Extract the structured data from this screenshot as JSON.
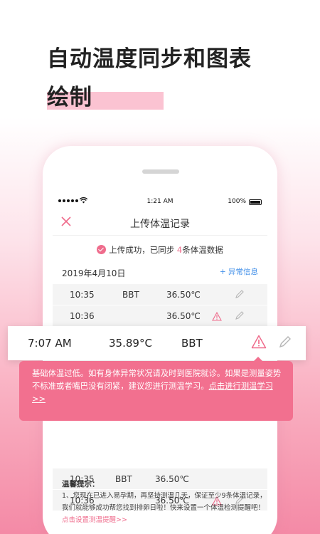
{
  "headline": {
    "line1": "自动温度同步和图表",
    "line2": "绘制"
  },
  "status_bar": {
    "time": "1:21 AM",
    "battery": "100%"
  },
  "nav": {
    "title": "上传体温记录"
  },
  "upload_message": {
    "prefix": "上传成功，已同步 ",
    "count": "4",
    "suffix": "条体温数据"
  },
  "date": "2019年4月10日",
  "anomaly_link": "+ 异常信息",
  "records_top": [
    {
      "time": "10:35",
      "type": "BBT",
      "temp": "36.50℃",
      "warning": false
    },
    {
      "time": "10:36",
      "type": "",
      "temp": "36.50℃",
      "warning": true
    }
  ],
  "highlight_record": {
    "time": "7:07 AM",
    "temp": "35.89°C",
    "type": "BBT"
  },
  "alert": {
    "text": "基础体温过低。如有身体异常状况请及时到医院就诊。如果是测量姿势不标准或者嘴巴没有闭紧，建议您进行测温学习。",
    "link": "点击进行测温学习>>"
  },
  "records_bottom": [
    {
      "time": "10:35",
      "type": "BBT",
      "temp": "36.50℃",
      "warning": false
    },
    {
      "time": "10:36",
      "type": "",
      "temp": "36.50℃",
      "warning": true
    }
  ],
  "tips": {
    "title": "温馨提示：",
    "body": "1、您现在已进入易孕期，再坚持测温几天，保证至少9条体温记录，我们就能够成功帮您找到排卵日啦！快来设置一个体温检测提醒吧！",
    "link": "点击设置测温提醒>>"
  },
  "colors": {
    "accent": "#ef6c8c",
    "alert_bg": "#f2708f",
    "link_blue": "#3f8ee8"
  }
}
